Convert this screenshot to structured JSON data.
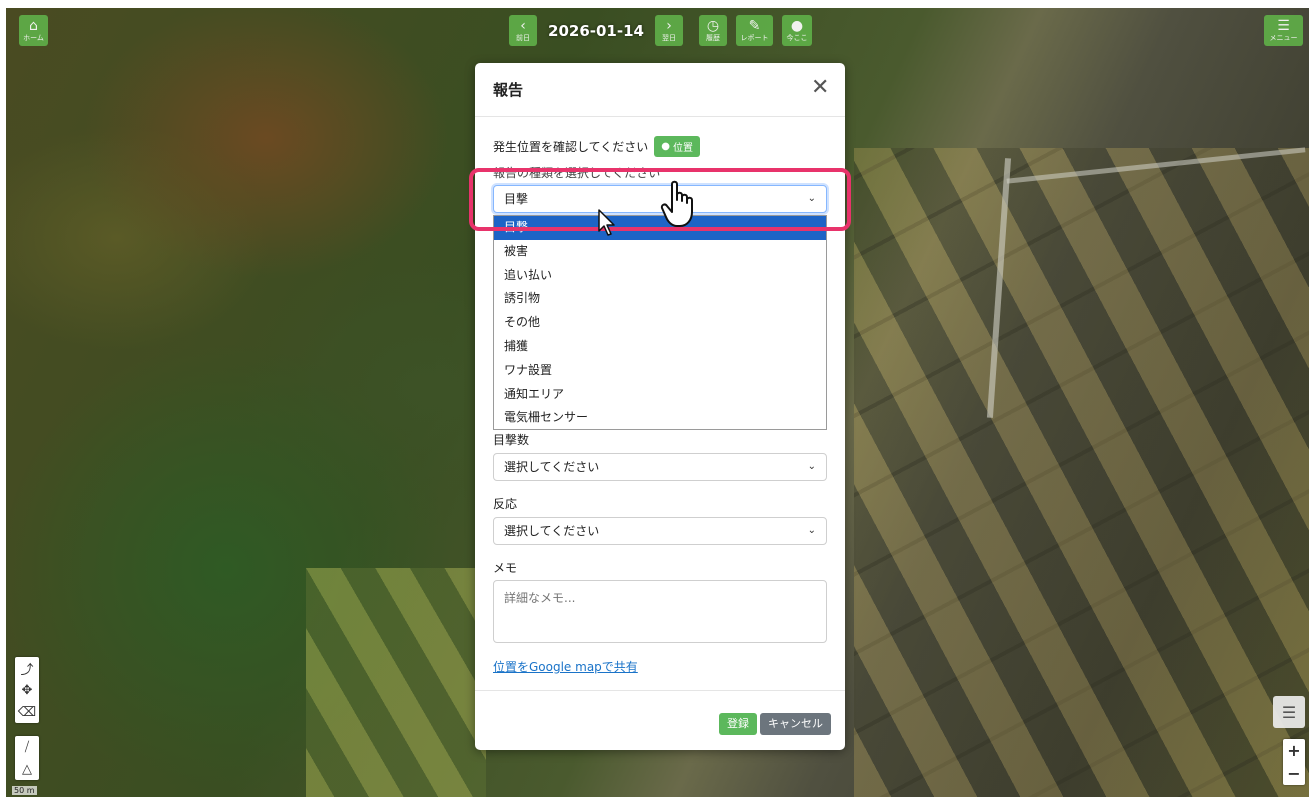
{
  "map": {
    "scale_label": "50 m"
  },
  "toolbar": {
    "home": {
      "label": "ホーム",
      "icon": "home-icon"
    },
    "prev": {
      "label": "前日",
      "icon": "chevron-left-icon"
    },
    "date": "2026-01-14",
    "next": {
      "label": "翌日",
      "icon": "chevron-right-icon"
    },
    "history": {
      "label": "履歴",
      "icon": "clock-icon"
    },
    "report": {
      "label": "レポート",
      "icon": "edit-icon"
    },
    "here": {
      "label": "今ここ",
      "icon": "location-pin-icon"
    },
    "menu": {
      "label": "メニュー",
      "icon": "hamburger-icon"
    }
  },
  "modal": {
    "title": "報告",
    "location_prompt": "発生位置を確認してください",
    "location_button": "位置",
    "type_label": "報告の種類を選択してください",
    "type_selected": "目撃",
    "type_options": [
      "目撃",
      "被害",
      "追い払い",
      "誘引物",
      "その他",
      "捕獲",
      "ワナ設置",
      "通知エリア",
      "電気柵センサー"
    ],
    "count_label": "目撃数",
    "count_placeholder": "選択してください",
    "reaction_label": "反応",
    "reaction_placeholder": "選択してください",
    "memo_label": "メモ",
    "memo_placeholder": "詳細なメモ...",
    "share_link": "位置をGoogle mapで共有",
    "submit": "登録",
    "cancel": "キャンセル"
  },
  "colors": {
    "accent_green": "#5cb85c",
    "highlight": "#e8336b",
    "option_selected": "#1d64c6"
  }
}
